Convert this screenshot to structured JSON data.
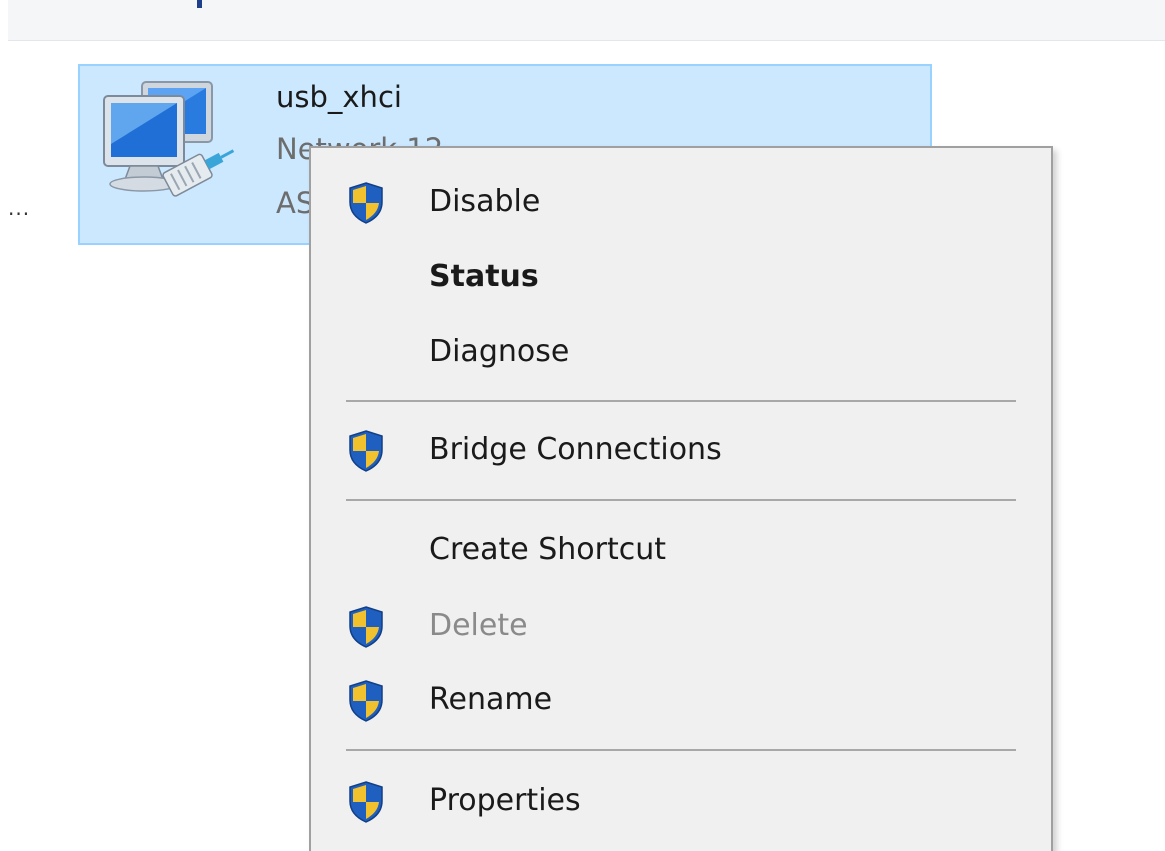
{
  "background_list": {
    "overflow_text": "..."
  },
  "adapter": {
    "name": "usb_xhci",
    "line2_visible": "Network 12",
    "line3_visible": "AS",
    "icon": "network-adapter-icon",
    "selected": true
  },
  "context_menu": {
    "items": [
      {
        "label": "Disable",
        "icon": "uac-shield-icon",
        "bold": false,
        "disabled": false
      },
      {
        "label": "Status",
        "icon": "",
        "bold": true,
        "disabled": false
      },
      {
        "label": "Diagnose",
        "icon": "",
        "bold": false,
        "disabled": false
      },
      {
        "label": "Bridge Connections",
        "icon": "uac-shield-icon",
        "bold": false,
        "disabled": false
      },
      {
        "label": "Create Shortcut",
        "icon": "",
        "bold": false,
        "disabled": false
      },
      {
        "label": "Delete",
        "icon": "uac-shield-icon",
        "bold": false,
        "disabled": true
      },
      {
        "label": "Rename",
        "icon": "uac-shield-icon",
        "bold": false,
        "disabled": false
      },
      {
        "label": "Properties",
        "icon": "uac-shield-icon",
        "bold": false,
        "disabled": false
      }
    ]
  },
  "colors": {
    "selection_fill": "#cce8ff",
    "selection_border": "#99d1ff",
    "menu_background": "#f0f0f0",
    "disabled_text": "#8a8a8a",
    "shield_blue": "#1f5fbf",
    "shield_yellow": "#f2c12e"
  }
}
